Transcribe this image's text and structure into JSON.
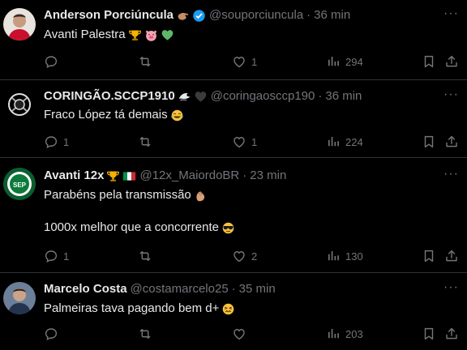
{
  "colors": {
    "background": "#000000",
    "text": "#e7e9ea",
    "muted": "#71767b",
    "divider": "#2f3336",
    "verified": "#1d9bf0"
  },
  "tweets": [
    {
      "name": "Anderson Porciúncula",
      "name_emojis": [
        "pinch-hand-emoji",
        "verified-badge"
      ],
      "handle": "@souporciuncula",
      "time": "36 min",
      "text_lines": [
        "Avanti Palestra"
      ],
      "text_emojis": [
        "trophy-emoji",
        "pig-face-emoji",
        "green-heart-emoji"
      ],
      "replies": "",
      "retweets": "",
      "likes": "1",
      "views": "294"
    },
    {
      "name": "CORINGÃO.SCCP1910",
      "name_emojis": [
        "eagle-emoji",
        "black-heart-emoji"
      ],
      "handle": "@coringaosccp190",
      "time": "36 min",
      "text_lines": [
        "Fraco López tá demais"
      ],
      "text_emojis": [
        "tears-of-joy-emoji"
      ],
      "replies": "1",
      "retweets": "",
      "likes": "1",
      "views": "224"
    },
    {
      "name": "Avanti 12x",
      "name_emojis": [
        "trophy-emoji",
        "italy-flag-emoji"
      ],
      "handle": "@12x_MaiordoBR",
      "time": "23 min",
      "text_lines": [
        "Parabéns pela transmissão",
        "",
        "1000x melhor que a concorrente"
      ],
      "text_emojis": [
        "clapping-hands-emoji",
        "sunglasses-emoji"
      ],
      "replies": "1",
      "retweets": "",
      "likes": "2",
      "views": "130"
    },
    {
      "name": "Marcelo Costa",
      "name_emojis": [],
      "handle": "@costamarcelo25",
      "time": "35 min",
      "text_lines": [
        "Palmeiras tava pagando bem d+"
      ],
      "text_emojis": [
        "persevering-face-emoji"
      ],
      "replies": "",
      "retweets": "",
      "likes": "",
      "views": "203"
    }
  ],
  "separator_dot": "·",
  "more_glyph": "···"
}
